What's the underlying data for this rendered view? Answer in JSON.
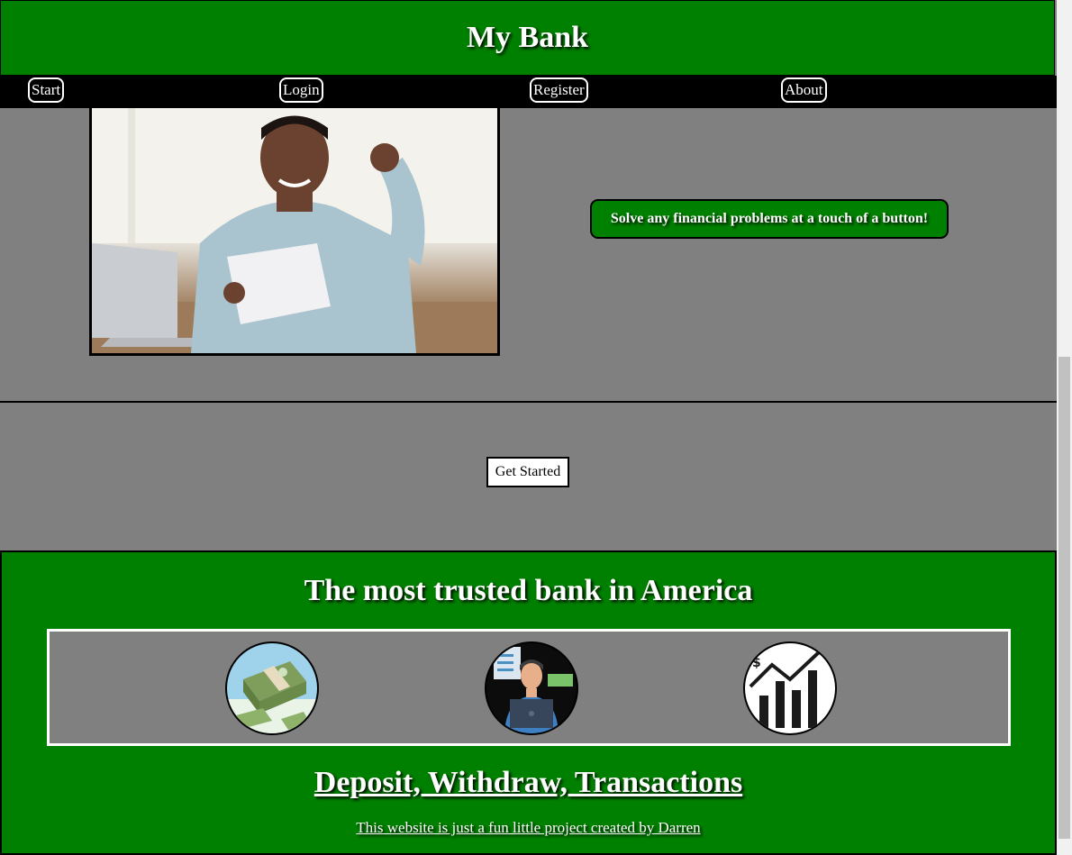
{
  "header": {
    "title": "My Bank"
  },
  "nav": {
    "items": [
      {
        "label": "Start"
      },
      {
        "label": "Login"
      },
      {
        "label": "Register"
      },
      {
        "label": "About"
      }
    ]
  },
  "hero": {
    "image_icon": "man-celebrating-photo",
    "tagline": "Solve any financial problems at a touch of a button!"
  },
  "cta": {
    "label": "Get Started"
  },
  "footer": {
    "heading": "The most trusted bank in America",
    "icons": [
      "money-stack-icon",
      "banker-laptop-icon",
      "growth-chart-icon"
    ],
    "services_link": "Deposit, Withdraw, Transactions",
    "credit_link": "This website is just a fun little project created by Darren"
  },
  "colors": {
    "brand": "#008000",
    "background": "#808080",
    "nav": "#000000"
  }
}
